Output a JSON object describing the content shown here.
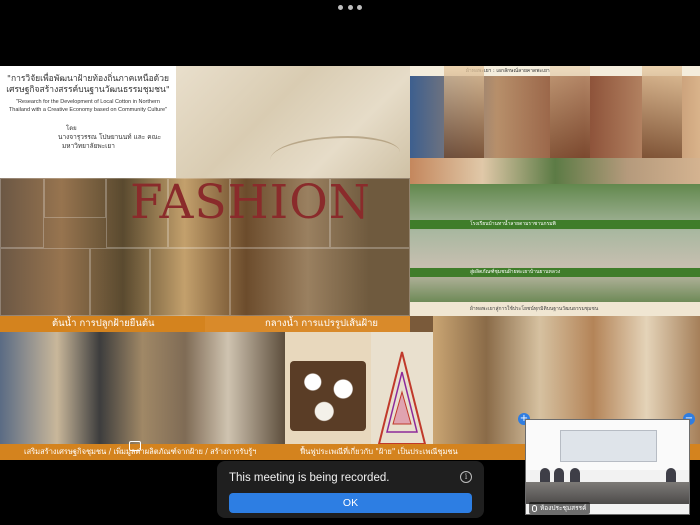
{
  "slide": {
    "title_thai": "\"การวิจัยเพื่อพัฒนาฝ้ายท้องถิ่นภาคเหนือด้วยเศรษฐกิจสร้างสรรค์บนฐานวัฒนธรรมชุมชน\"",
    "title_en": "\"Research for the Development of Local Cotton in Northern Thailand with a Creative Economy based on Community Culture\"",
    "by_label": "โดย",
    "authors": "นางจารุวรรณ โปษยานนท์ และ คณะ",
    "university": "มหาวิทยาลัยพะเยา",
    "fashion_word": "FASHION",
    "top_right_caption": "ผ้าทอพะเยา : เอกลักษณ์ลายคาดพะเยา",
    "green_caption_1": "โรงเรียนบ้านทาน้ำลายดามราชานกรมพิ",
    "green_caption_2": "สู่ผลิตภัณฑ์ชุมชนฝ้ายพะเยาบ้านยานหลวง",
    "mid_right_caption": "ผ้าทอพะเยาสู่การใช้ประโยชน์ทุกมิติบนฐานวัฒนธรรมชุมชน",
    "band_upstream": "ต้นน้ำ การปลูกฝ้ายยืนต้น",
    "band_midstream": "กลางน้ำ การแปรรูปเส้นฝ้าย",
    "band_bottom": "เสริมสร้างเศรษฐกิจชุมชน / เพิ่มมูลค่าผลิตภัณฑ์จากฝ้าย / สร้างการรับรู้ฯ",
    "band_bottom_right": "ฟื้นฟูประเพณีที่เกี่ยวกับ \"ฝ้าย\" เป็นประเพณีชุมชน"
  },
  "meeting": {
    "recording_message": "This meeting is being recorded.",
    "ok_label": "OK",
    "info_glyph": "i",
    "participant_name": "ห้องประชุมสรรค์",
    "plus_glyph": "+",
    "minus_glyph": "−"
  }
}
